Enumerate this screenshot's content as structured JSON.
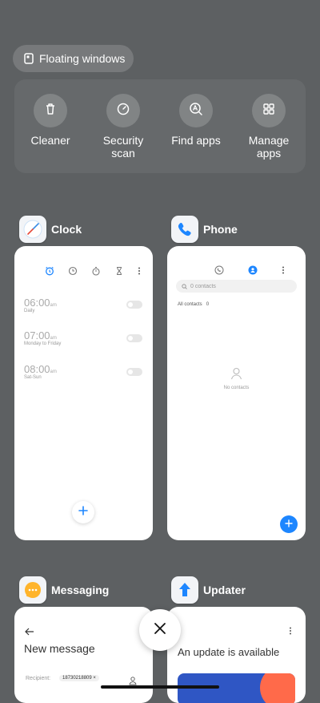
{
  "floating_windows": {
    "label": "Floating windows",
    "icon": "floating-window-icon"
  },
  "quick_actions": [
    {
      "label": "Cleaner",
      "icon": "trash-icon"
    },
    {
      "label": "Security scan",
      "icon": "security-scan-icon"
    },
    {
      "label": "Find apps",
      "icon": "find-apps-icon"
    },
    {
      "label": "Manage apps",
      "icon": "grid-icon"
    }
  ],
  "cards": {
    "clock": {
      "title": "Clock",
      "alarms": [
        {
          "time": "06:00",
          "ampm": "am",
          "repeat": "Daily"
        },
        {
          "time": "07:00",
          "ampm": "am",
          "repeat": "Monday to Friday"
        },
        {
          "time": "08:00",
          "ampm": "am",
          "repeat": "Sat-Sun"
        }
      ]
    },
    "phone": {
      "title": "Phone",
      "search_placeholder": "0 contacts",
      "all_contacts": "All contacts",
      "count": "0",
      "empty": "No contacts"
    },
    "messaging": {
      "title": "Messaging",
      "heading": "New message",
      "recipient_label": "Recipient:",
      "recipient_value": "18730218809"
    },
    "updater": {
      "title": "Updater",
      "heading": "An update is available"
    }
  },
  "colors": {
    "background": "#5d6062",
    "accent": "#1d86ff"
  }
}
